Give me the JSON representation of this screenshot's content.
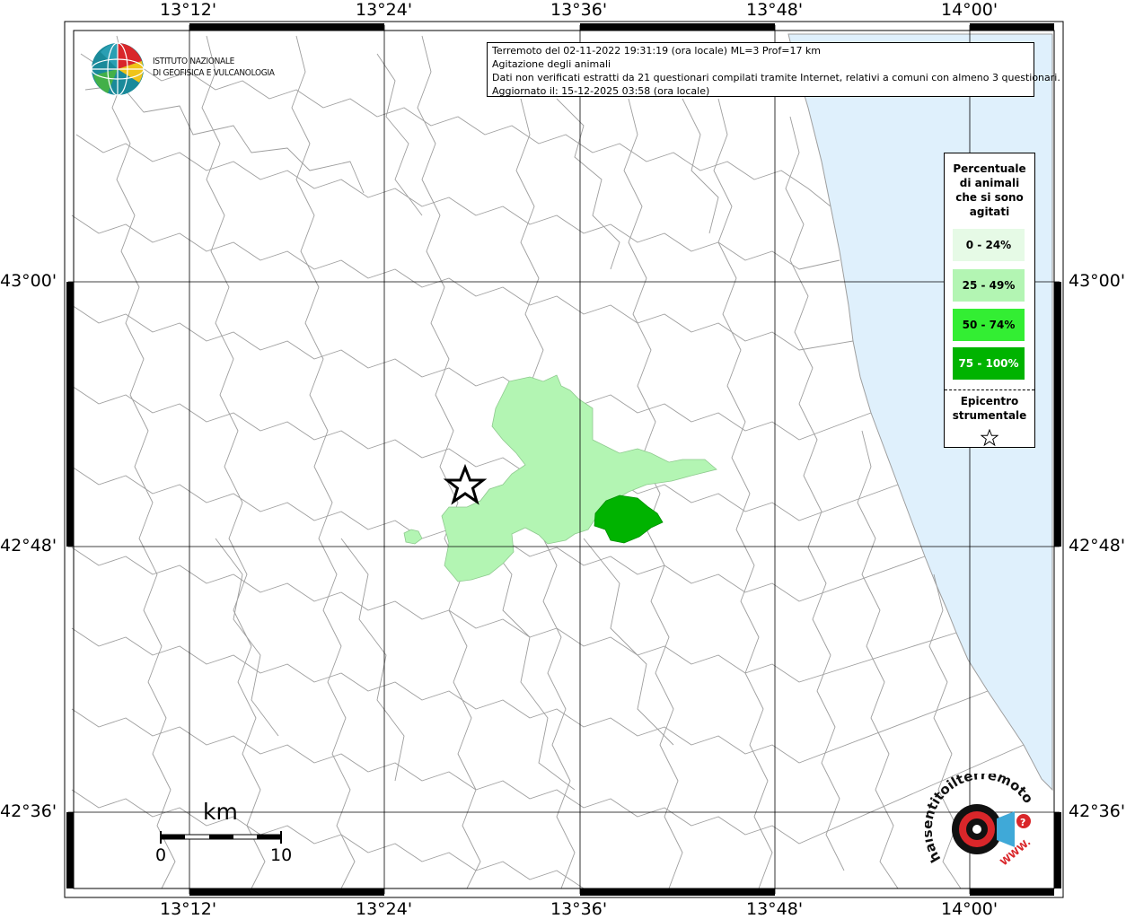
{
  "info": {
    "line1": "Terremoto del 02-11-2022 19:31:19 (ora locale) ML=3 Prof=17 km",
    "line2": "Agitazione degli animali",
    "line3": "Dati non verificati estratti da 21 questionari compilati tramite Internet, relativi a comuni con almeno 3 questionari.",
    "line4": "Aggiornato il: 15-12-2025 03:58 (ora locale)"
  },
  "legend": {
    "title_lines": [
      "Percentuale",
      "di animali",
      "che si sono",
      "agitati"
    ],
    "items": [
      {
        "label": "0 - 24%",
        "color": "#e6fae6"
      },
      {
        "label": "25 - 49%",
        "color": "#b3f5b3"
      },
      {
        "label": "50 - 74%",
        "color": "#33ee33"
      },
      {
        "label": "75 - 100%",
        "color": "#00b300"
      }
    ],
    "epicenter_lines": [
      "Epicentro",
      "strumentale"
    ]
  },
  "axes": {
    "top": [
      "13°12'",
      "13°24'",
      "13°36'",
      "13°48'",
      "14°00'"
    ],
    "bottom": [
      "13°12'",
      "13°24'",
      "13°36'",
      "13°48'",
      "14°00'"
    ],
    "left": [
      "43°00'",
      "42°48'",
      "42°36'"
    ],
    "right": [
      "43°00'",
      "42°48'",
      "42°36'"
    ]
  },
  "logo_ingv": {
    "line1": "ISTITUTO NAZIONALE",
    "line2": "DI GEOFISICA E VULCANOLOGIA"
  },
  "scale": {
    "unit": "km",
    "min": "0",
    "max": "10"
  },
  "logo_hst": {
    "text": "haisentitoilterremoto.it",
    "www": "WWW."
  },
  "colors": {
    "sea": "#dff0fc",
    "boundary": "#9e9e9e",
    "grid": "#000000"
  }
}
